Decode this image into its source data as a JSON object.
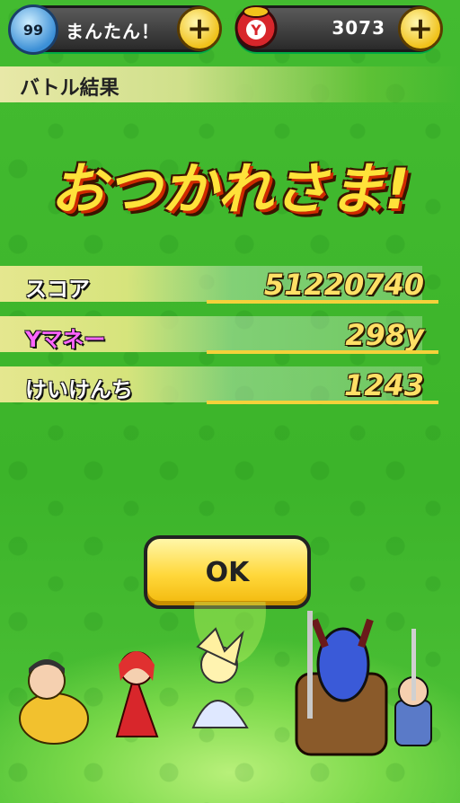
{
  "hud": {
    "stamina_value": "99",
    "stamina_label": "まんたん！",
    "money_value": "3073",
    "stamina_icon": "stamina-orb-icon",
    "money_icon": "y-coin-pouch-icon",
    "plus_label": "+"
  },
  "header": {
    "title": "バトル結果"
  },
  "title_banner": "おつかれさま!",
  "results": [
    {
      "label": "スコア",
      "value": "51220740",
      "label_color": "#ffffff"
    },
    {
      "label": "Yマネー",
      "value": "298y",
      "label_color": "#ff66ff"
    },
    {
      "label": "けいけんち",
      "value": "1243",
      "label_color": "#ffffff"
    }
  ],
  "ok_button": {
    "label": "OK"
  },
  "colors": {
    "background": "#3cb42a",
    "accent": "#ffd73a",
    "title": "#ffe23a"
  }
}
